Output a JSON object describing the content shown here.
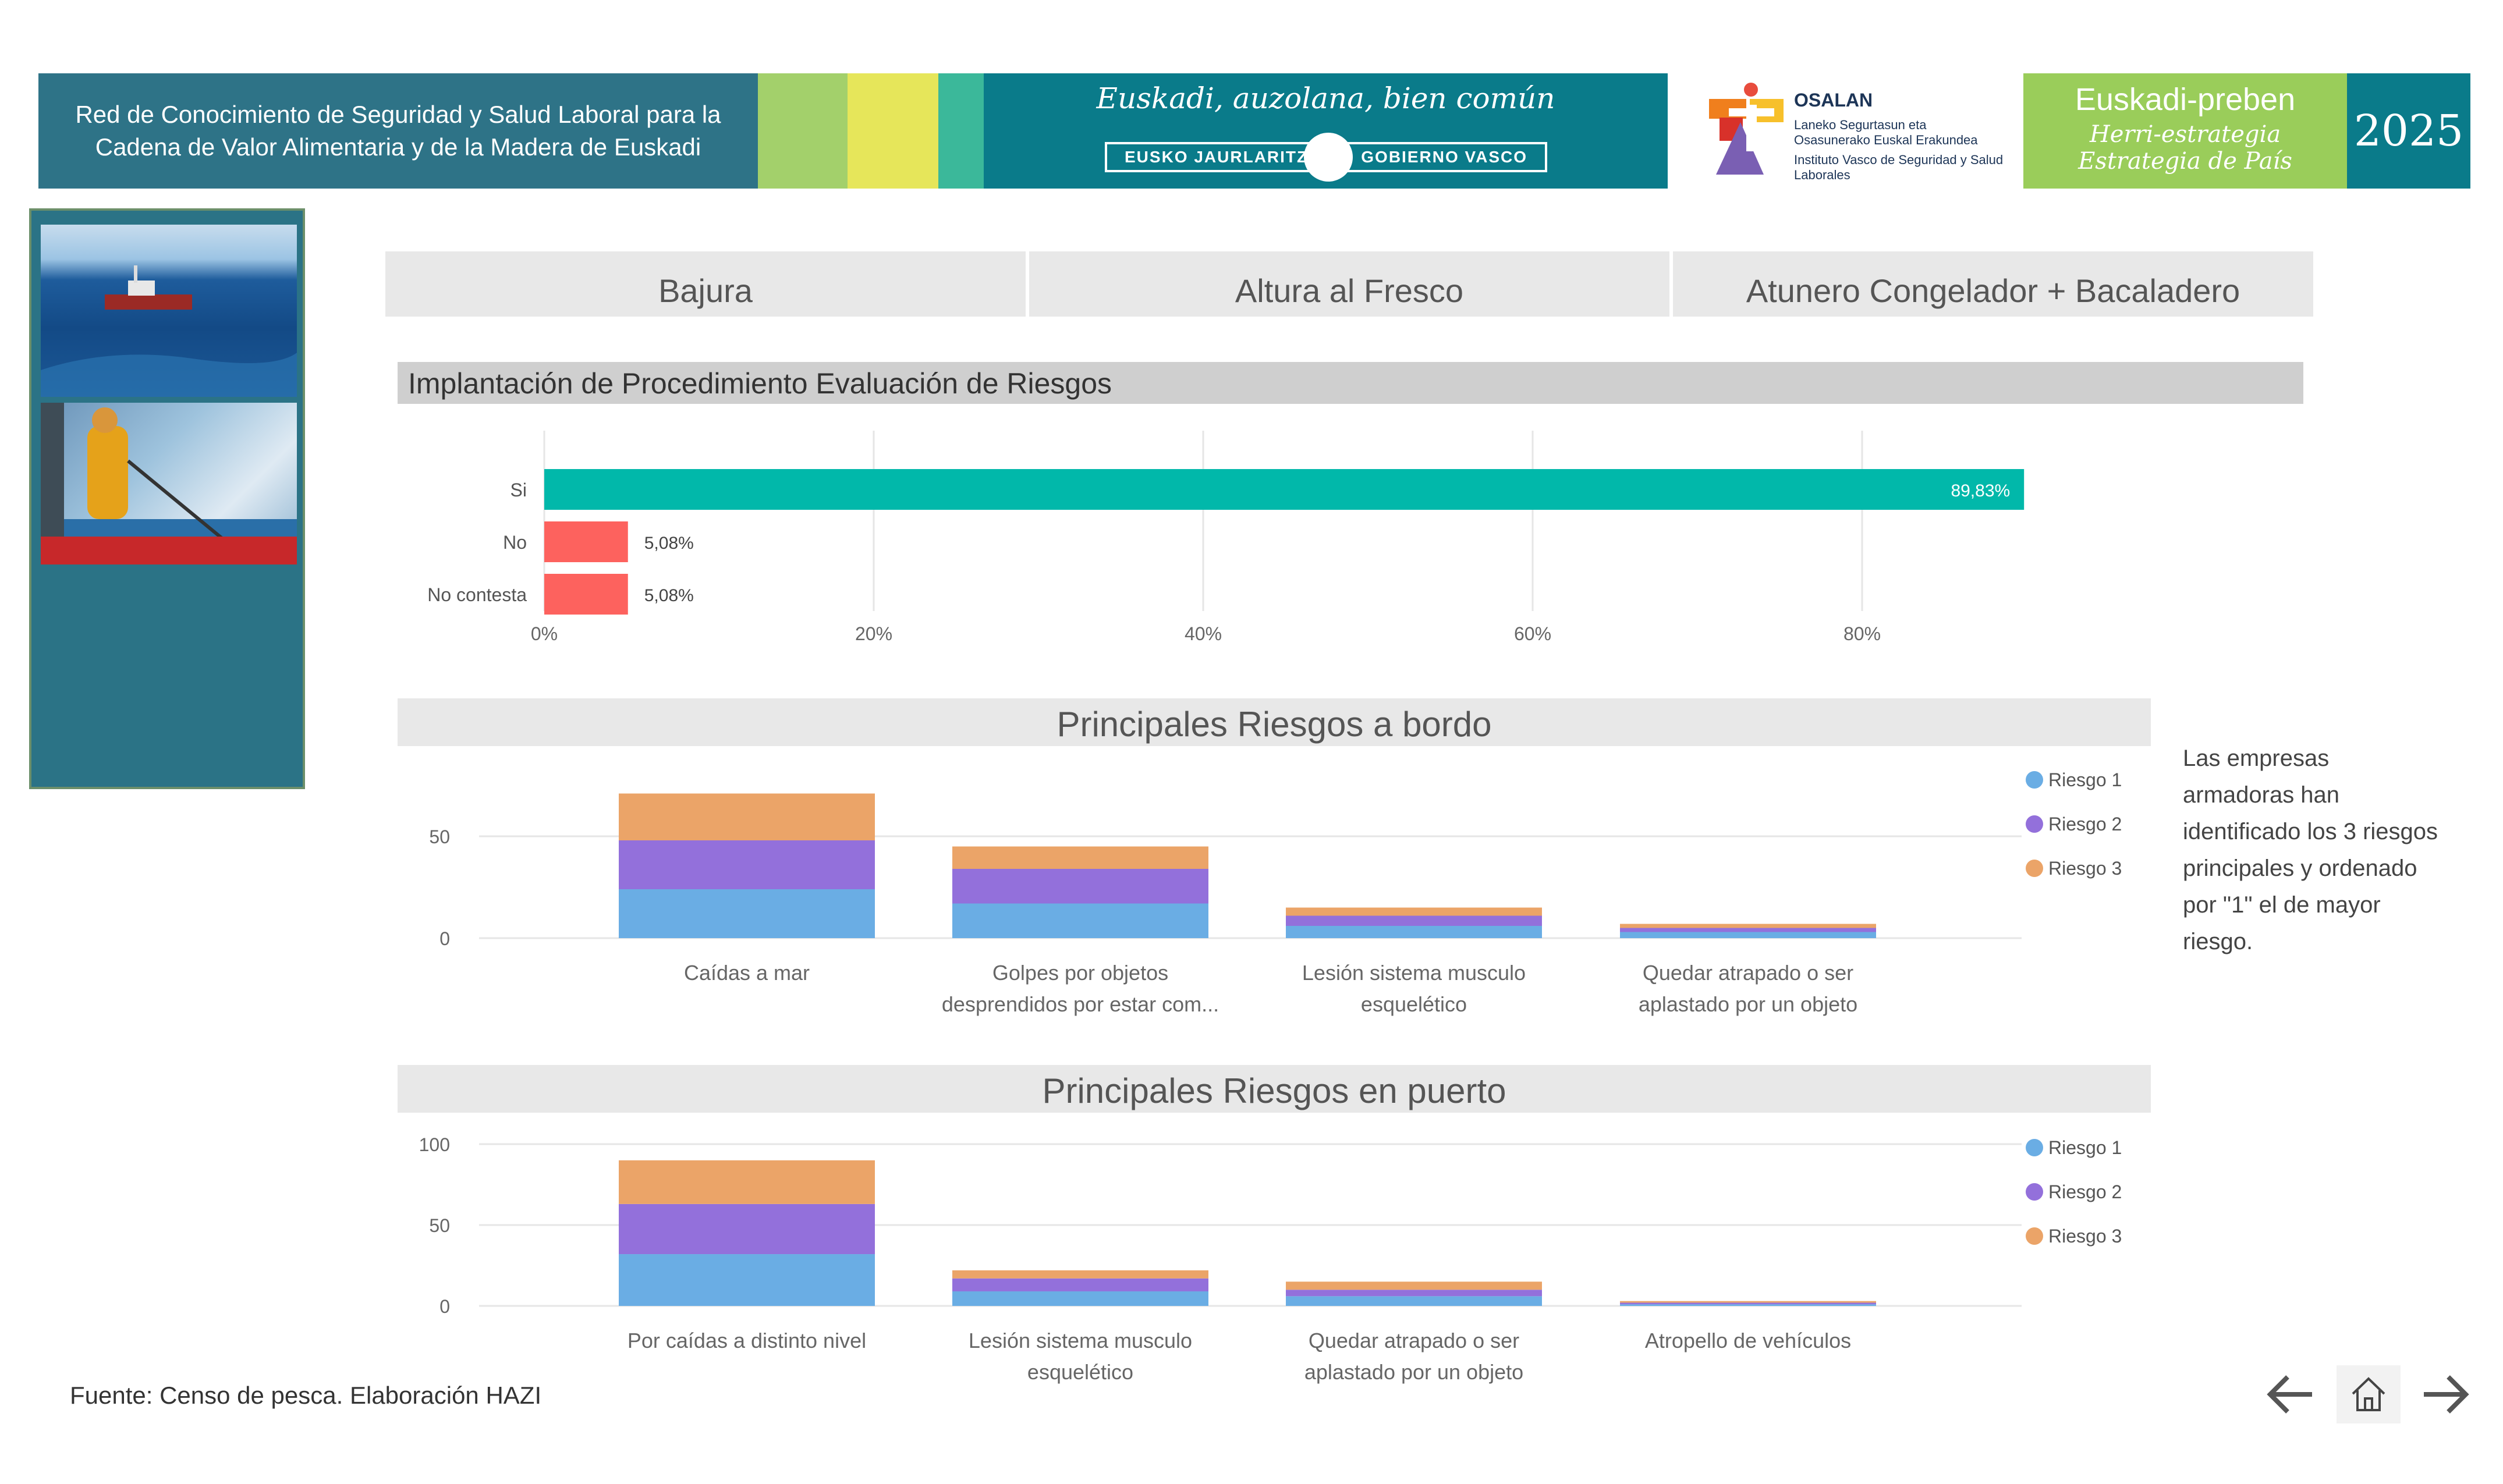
{
  "header": {
    "title_line1": "Red de Conocimiento de Seguridad y Salud Laboral para la",
    "title_line2": "Cadena de Valor Alimentaria y de la Madera de Euskadi",
    "slogan": "Euskadi, auzolana, bien común",
    "gov_left": "EUSKO JAURLARITZA",
    "gov_right": "GOBIERNO VASCO",
    "osalan_name": "OSALAN",
    "osalan_line1": "Laneko Segurtasun eta Osasunerako Euskal Erakundea",
    "osalan_line2": "Instituto Vasco de Seguridad y Salud Laborales",
    "preben_title": "Euskadi-preben",
    "preben_sub1": "Herri-estrategia",
    "preben_sub2": "Estrategia de País",
    "year": "2025",
    "colors": {
      "left": "#2e7387",
      "stripe1": "#a3d06b",
      "stripe2": "#e6e65a",
      "stripe3": "#3bb89a",
      "center": "#0a7b8a",
      "preben": "#9acd5a"
    }
  },
  "tabs": [
    {
      "label": "Bajura"
    },
    {
      "label": "Altura al Fresco"
    },
    {
      "label": "Atunero Congelador + Bacaladero"
    }
  ],
  "side_note": "Las empresas armadoras han identificado los 3 riesgos principales y ordenado por \"1\" el de mayor riesgo.",
  "source": "Fuente: Censo de pesca. Elaboración HAZI",
  "nav": {
    "back_icon": "arrow-left-icon",
    "home_icon": "home-icon",
    "next_icon": "arrow-right-icon"
  },
  "chart_data": [
    {
      "type": "bar",
      "orientation": "horizontal",
      "title": "Implantación de Procedimiento Evaluación de Riesgos",
      "categories": [
        "Si",
        "No",
        "No contesta"
      ],
      "values": [
        89.83,
        5.08,
        5.08
      ],
      "data_labels": [
        "89,83%",
        "5,08%",
        "5,08%"
      ],
      "colors": [
        "#01b8aa",
        "#fd625e",
        "#fd625e"
      ],
      "xlim": [
        0,
        100
      ],
      "xticks": [
        0,
        20,
        40,
        60,
        80
      ],
      "xtick_labels": [
        "0%",
        "20%",
        "40%",
        "60%",
        "80%"
      ],
      "grid": true
    },
    {
      "type": "bar",
      "stacked": true,
      "title": "Principales Riesgos a bordo",
      "categories_line1": [
        "Caídas a mar",
        "Golpes por objetos",
        "Lesión sistema musculo",
        "Quedar atrapado o ser"
      ],
      "categories_line2": [
        "",
        "desprendidos por estar com...",
        "esquelético",
        "aplastado por un objeto"
      ],
      "series": [
        {
          "name": "Riesgo 1",
          "color": "#6aade4",
          "values": [
            24,
            17,
            6,
            3
          ]
        },
        {
          "name": "Riesgo 2",
          "color": "#9370db",
          "values": [
            24,
            17,
            5,
            2
          ]
        },
        {
          "name": "Riesgo 3",
          "color": "#eba468",
          "values": [
            23,
            11,
            4,
            2
          ]
        }
      ],
      "ylim": [
        0,
        72
      ],
      "yticks": [
        0,
        50
      ],
      "legend": "right",
      "grid": true
    },
    {
      "type": "bar",
      "stacked": true,
      "title": "Principales Riesgos en puerto",
      "categories_line1": [
        "Por caídas a distinto nivel",
        "Lesión sistema musculo",
        "Quedar atrapado o ser",
        "Atropello de vehículos"
      ],
      "categories_line2": [
        "",
        "esquelético",
        "aplastado por un objeto",
        ""
      ],
      "series": [
        {
          "name": "Riesgo 1",
          "color": "#6aade4",
          "values": [
            32,
            9,
            6,
            1
          ]
        },
        {
          "name": "Riesgo 2",
          "color": "#9370db",
          "values": [
            31,
            8,
            4,
            1
          ]
        },
        {
          "name": "Riesgo 3",
          "color": "#eba468",
          "values": [
            27,
            5,
            5,
            1
          ]
        }
      ],
      "ylim": [
        0,
        100
      ],
      "yticks": [
        0,
        50,
        100
      ],
      "legend": "right",
      "grid": true
    }
  ]
}
